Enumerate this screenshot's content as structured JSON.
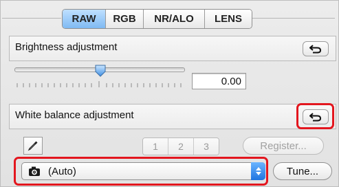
{
  "tabs": [
    {
      "label": "RAW",
      "active": true
    },
    {
      "label": "RGB",
      "active": false
    },
    {
      "label": "NR/ALO",
      "active": false
    },
    {
      "label": "LENS",
      "active": false
    }
  ],
  "brightness": {
    "title": "Brightness adjustment",
    "value": "0.00",
    "reset_icon": "undo-arrow-icon",
    "slider_fraction": 0.5
  },
  "white_balance": {
    "title": "White balance adjustment",
    "reset_icon": "undo-arrow-icon",
    "picker_icon": "eyedropper-icon",
    "presets": [
      "1",
      "2",
      "3"
    ],
    "register_label": "Register...",
    "selected_value": "(Auto)",
    "select_icon": "camera-icon",
    "tune_label": "Tune..."
  },
  "colors": {
    "accent": "#7fbaf3",
    "highlight": "#e3161e",
    "select_arrow": "#1f74e0"
  }
}
